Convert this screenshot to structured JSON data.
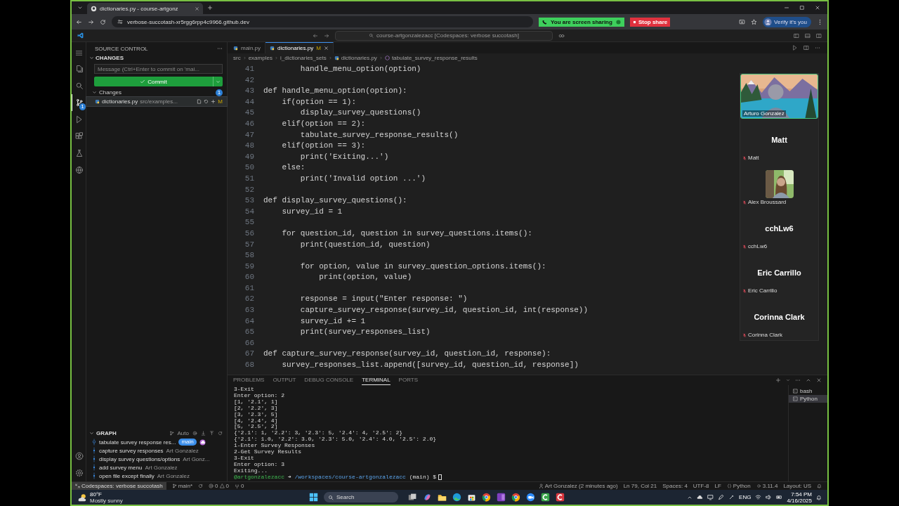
{
  "browser": {
    "tab_title": "dictionaries.py - course-artgonz",
    "url": "verbose-succotash-xr5rgg6rpp4c9966.github.dev",
    "sharing_label": "You are screen sharing",
    "stop_share": "Stop share",
    "profile_button": "Verify it's you"
  },
  "title_bar": {
    "search": "course-artgonzalezacc [Codespaces: verbose succotash]"
  },
  "activity_bar": [
    {
      "selected": false
    },
    {
      "selected": false
    },
    {
      "selected": true,
      "badge": "1"
    },
    {
      "selected": false
    },
    {
      "selected": false
    },
    {
      "selected": false
    },
    {
      "selected": false
    }
  ],
  "source_control": {
    "title": "SOURCE CONTROL",
    "section": "CHANGES",
    "message_placeholder": "Message (Ctrl+Enter to commit on 'mai...",
    "commit_button": "Commit",
    "changes_label": "Changes",
    "changes_count": "1",
    "files": [
      {
        "name": "dictionaries.py",
        "path": "src/examples...",
        "status": "M",
        "selected": true
      }
    ]
  },
  "graph": {
    "title": "GRAPH",
    "filter": "Auto",
    "commits": [
      {
        "message": "tabulate survey response res...",
        "branch": "main",
        "current": true
      },
      {
        "message": "capture survey responses",
        "author": "Art Gonzalez",
        "current": false
      },
      {
        "message": "display survey questions/options",
        "author": "Art Gonz...",
        "current": false
      },
      {
        "message": "add survey menu",
        "author": "Art Gonzalez",
        "current": false
      },
      {
        "message": "open file except finally",
        "author": "Art Gonzalez",
        "current": false
      }
    ]
  },
  "editor": {
    "tabs": [
      {
        "label": "main.py",
        "selected": false
      },
      {
        "label": "dictionaries.py",
        "status": "M",
        "selected": true
      }
    ],
    "breadcrumb": [
      "src",
      "examples",
      "i_dictionaries_sets",
      "dictionaries.py",
      "tabulate_survey_response_results"
    ],
    "lines": [
      {
        "number": "41",
        "text": "        handle_menu_option(option)"
      },
      {
        "number": "42"
      },
      {
        "number": "43",
        "text": "def handle_menu_option(option):"
      },
      {
        "number": "44",
        "text": "    if(option == 1):"
      },
      {
        "number": "45",
        "text": "        display_survey_questions()"
      },
      {
        "number": "46",
        "text": "    elif(option == 2):"
      },
      {
        "number": "47",
        "text": "        tabulate_survey_response_results()"
      },
      {
        "number": "48",
        "text": "    elif(option == 3):"
      },
      {
        "number": "49",
        "text": "        print('Exiting...')"
      },
      {
        "number": "50",
        "text": "    else:"
      },
      {
        "number": "51",
        "text": "        print('Invalid option ...')"
      },
      {
        "number": "52"
      },
      {
        "number": "53",
        "text": "def display_survey_questions():"
      },
      {
        "number": "54",
        "text": "    survey_id = 1"
      },
      {
        "number": "55"
      },
      {
        "number": "56",
        "text": "    for question_id, question in survey_questions.items():"
      },
      {
        "number": "57",
        "text": "        print(question_id, question)"
      },
      {
        "number": "58"
      },
      {
        "number": "59",
        "text": "        for option, value in survey_question_options.items():"
      },
      {
        "number": "60",
        "text": "            print(option, value)"
      },
      {
        "number": "61"
      },
      {
        "number": "62",
        "text": "        response = input(\"Enter response: \")"
      },
      {
        "number": "63",
        "text": "        capture_survey_response(survey_id, question_id, int(response))"
      },
      {
        "number": "64",
        "text": "        survey_id += 1"
      },
      {
        "number": "65",
        "text": "        print(survey_responses_list)"
      },
      {
        "number": "66"
      },
      {
        "number": "67",
        "text": "def capture_survey_response(survey_id, question_id, response):"
      },
      {
        "number": "68",
        "text": "    survey_responses_list.append([survey_id, question_id, response])"
      }
    ]
  },
  "panel": {
    "tabs": [
      {
        "label": "PROBLEMS",
        "selected": false
      },
      {
        "label": "OUTPUT",
        "selected": false
      },
      {
        "label": "DEBUG CONSOLE",
        "selected": false
      },
      {
        "label": "TERMINAL",
        "selected": true
      },
      {
        "label": "PORTS",
        "selected": false
      }
    ],
    "terminal_lines": [
      "3-Exit",
      "Enter option: 2",
      "[1, '2.1', 1]",
      "[2, '2.2', 3]",
      "[3, '2.3', 5]",
      "[4, '2.4', 4]",
      "[5, '2.5', 2]",
      "{'2.1': 1, '2.2': 3, '2.3': 5, '2.4': 4, '2.5': 2}",
      "{'2.1': 1.0, '2.2': 3.0, '2.3': 5.0, '2.4': 4.0, '2.5': 2.0}",
      "1-Enter Survey Responses",
      "2-Get Survey Results",
      "3-Exit",
      "Enter option: 3",
      "Exiting..."
    ],
    "prompt": {
      "user": "@artgonzalezacc",
      "arrow": "➜",
      "path": "/workspaces/course-artgonzalezacc",
      "branch": "(main)",
      "symbol": "$"
    },
    "terminals": [
      {
        "label": "bash",
        "selected": false
      },
      {
        "label": "Python",
        "selected": true
      }
    ]
  },
  "meeting": {
    "participants": [
      {
        "kind": "video",
        "name": "Arturo Gonzalez",
        "muted": false
      },
      {
        "kind": "name",
        "title": "Matt",
        "name": "Matt",
        "muted": true
      },
      {
        "name": "Alex Broussard",
        "muted": true
      },
      {
        "kind": "name",
        "title": "cchLw6",
        "name": "cchLw6",
        "muted": true
      },
      {
        "kind": "name",
        "title": "Eric Carrillo",
        "name": "Eric Carrillo",
        "muted": true
      },
      {
        "kind": "name",
        "title": "Corinna Clark",
        "name": "Corinna Clark",
        "muted": true
      }
    ]
  },
  "status_bar": {
    "remote": "Codespaces: verbose succotash",
    "branch": "main*",
    "errors": "0",
    "warnings": "0",
    "ports": "0",
    "blame": "Art Gonzalez (2 minutes ago)",
    "position": "Ln 79, Col 21",
    "indent": "Spaces: 4",
    "encoding": "UTF-8",
    "eol": "LF",
    "language": "Python",
    "version": "3.11.4",
    "layout": "Layout: US"
  },
  "taskbar": {
    "temperature": "80°F",
    "condition": "Mostly sunny",
    "search": "Search",
    "language": "ENG",
    "time": "7:54 PM",
    "date": "4/16/2025"
  }
}
